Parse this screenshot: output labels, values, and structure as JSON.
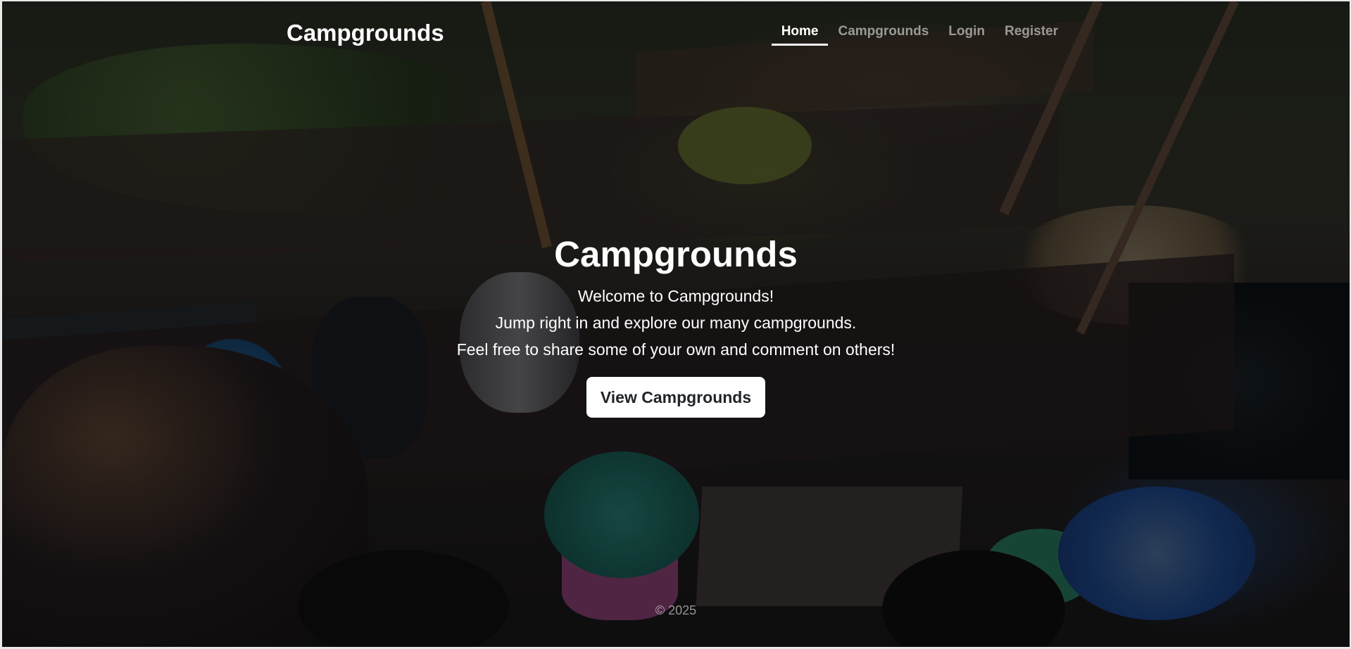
{
  "navbar": {
    "brand": "Campgrounds",
    "links": [
      {
        "label": "Home",
        "active": true
      },
      {
        "label": "Campgrounds",
        "active": false
      },
      {
        "label": "Login",
        "active": false
      },
      {
        "label": "Register",
        "active": false
      }
    ]
  },
  "hero": {
    "title": "Campgrounds",
    "lines": [
      "Welcome to Campgrounds!",
      "Jump right in and explore our many campgrounds.",
      "Feel free to share some of your own and comment on others!"
    ],
    "cta_label": "View Campgrounds"
  },
  "footer": {
    "text": "© 2025"
  },
  "colors": {
    "overlay": "rgba(0,0,0,0.5)",
    "text": "#ffffff",
    "muted_text": "rgba(255,255,255,0.55)",
    "button_bg": "#ffffff",
    "button_text": "#212529"
  }
}
